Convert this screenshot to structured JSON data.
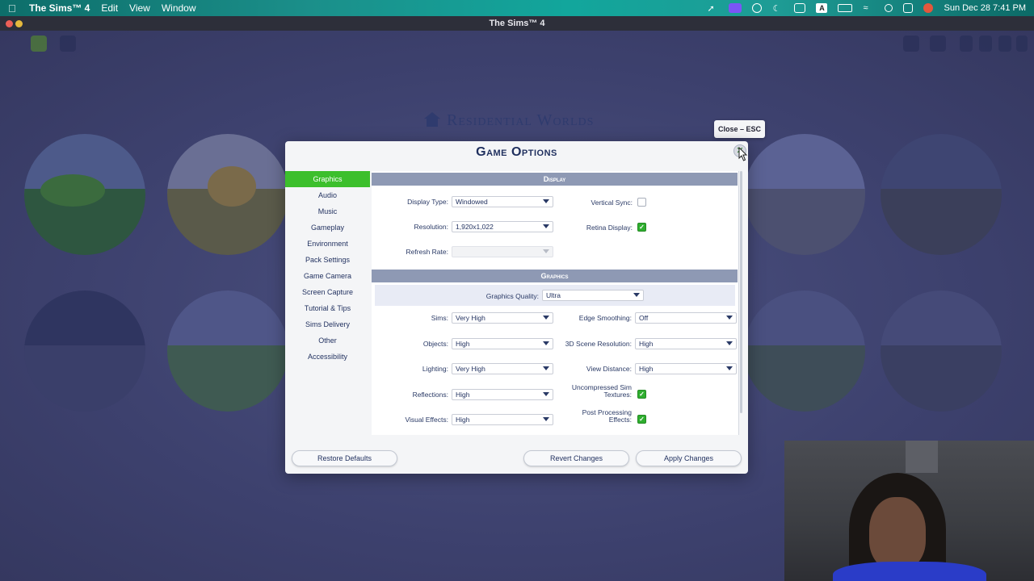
{
  "menubar": {
    "app_name": "The Sims™ 4",
    "menus": [
      "Edit",
      "View",
      "Window"
    ],
    "clock": "Sun Dec 28  7:41 PM",
    "input_badge": "A"
  },
  "window": {
    "title": "The Sims™ 4"
  },
  "background": {
    "title": "Residential Worlds"
  },
  "tooltip": {
    "text": "Close – ESC"
  },
  "dialog": {
    "title": "Game Options",
    "nav": [
      "Graphics",
      "Audio",
      "Music",
      "Gameplay",
      "Environment",
      "Pack Settings",
      "Game Camera",
      "Screen Capture",
      "Tutorial & Tips",
      "Sims Delivery",
      "Other",
      "Accessibility"
    ],
    "active_nav": "Graphics",
    "display": {
      "heading": "Display",
      "display_type": {
        "label": "Display Type:",
        "value": "Windowed"
      },
      "resolution": {
        "label": "Resolution:",
        "value": "1,920x1,022"
      },
      "refresh_rate": {
        "label": "Refresh Rate:",
        "value": ""
      },
      "vertical_sync": {
        "label": "Vertical Sync:",
        "checked": false
      },
      "retina_display": {
        "label": "Retina Display:",
        "checked": true
      }
    },
    "graphics": {
      "heading": "Graphics",
      "quality": {
        "label": "Graphics Quality:",
        "value": "Ultra"
      },
      "sims": {
        "label": "Sims:",
        "value": "Very High"
      },
      "objects": {
        "label": "Objects:",
        "value": "High"
      },
      "lighting": {
        "label": "Lighting:",
        "value": "Very High"
      },
      "reflections": {
        "label": "Reflections:",
        "value": "High"
      },
      "visual_effects": {
        "label": "Visual Effects:",
        "value": "High"
      },
      "edge_smoothing": {
        "label": "Edge Smoothing:",
        "value": "Off"
      },
      "scene_resolution": {
        "label": "3D Scene Resolution:",
        "value": "High"
      },
      "view_distance": {
        "label": "View Distance:",
        "value": "High"
      },
      "uncompressed_line1": "Uncompressed Sim",
      "uncompressed_line2": "Textures:",
      "post_line1": "Post Processing",
      "post_line2": "Effects:",
      "uncompressed_checked": true,
      "post_processing_checked": true
    },
    "buttons": {
      "restore": "Restore Defaults",
      "revert": "Revert Changes",
      "apply": "Apply Changes"
    }
  },
  "colors": {
    "accent_green": "#3cbf2c",
    "section_header": "#8e99b4",
    "title_blue": "#1f2f5e"
  }
}
